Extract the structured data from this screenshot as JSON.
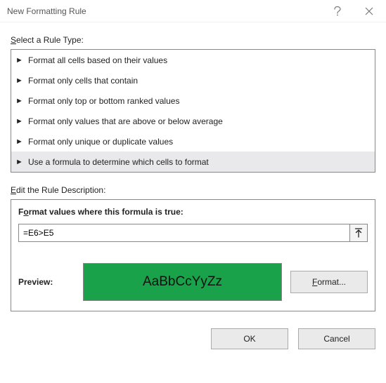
{
  "titlebar": {
    "title": "New Formatting Rule"
  },
  "labels": {
    "select_rule_type": "Select a Rule Type:",
    "edit_rule_desc": "Edit the Rule Description:",
    "format_values_true": "Format values where this formula is true:",
    "preview": "Preview:",
    "format_btn": "Format...",
    "ok": "OK",
    "cancel": "Cancel"
  },
  "rule_types": [
    "Format all cells based on their values",
    "Format only cells that contain",
    "Format only top or bottom ranked values",
    "Format only values that are above or below average",
    "Format only unique or duplicate values",
    "Use a formula to determine which cells to format"
  ],
  "formula": {
    "value": "=E6>E5"
  },
  "preview": {
    "sample": "AaBbCcYyZz",
    "bg": "#1aa24a"
  }
}
